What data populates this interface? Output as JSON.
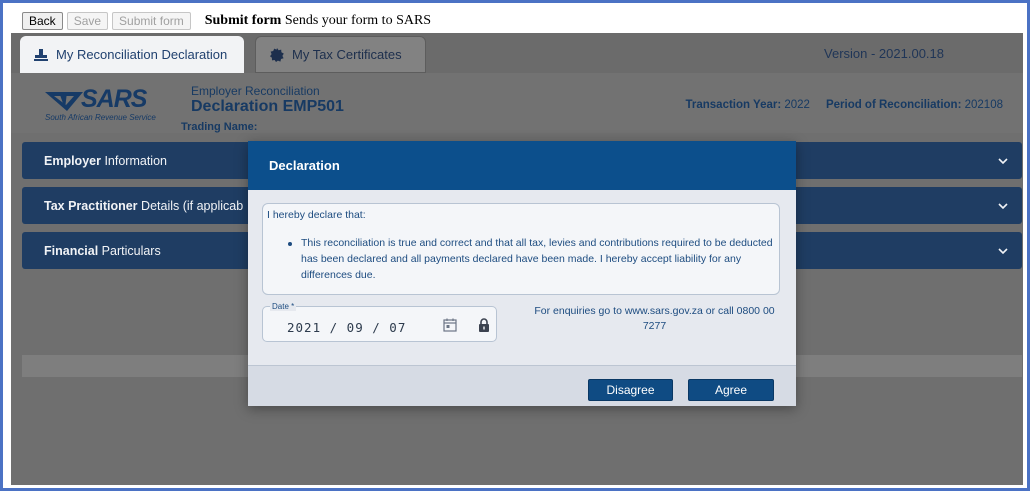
{
  "toolbar": {
    "back_label": "Back",
    "save_label": "Save",
    "submit_label": "Submit form",
    "note_bold": "Submit form",
    "note_text": " Sends your form to SARS"
  },
  "tabs": [
    {
      "label": "My Reconciliation Declaration",
      "icon": "stamp-icon",
      "active": true
    },
    {
      "label": "My Tax Certificates",
      "icon": "seal-icon",
      "active": false
    }
  ],
  "version": "Version - 2021.00.18",
  "header": {
    "logo_word": "SARS",
    "logo_tagline": "South African Revenue Service",
    "subtitle": "Employer Reconciliation",
    "title": "Declaration EMP501",
    "trading_name_label": "Trading Name:",
    "transaction_year_label": "Transaction Year:",
    "transaction_year_value": "2022",
    "period_label": "Period of Reconciliation:",
    "period_value": "202108"
  },
  "sections": [
    {
      "bold": "Employer",
      "rest": " Information"
    },
    {
      "bold": "Tax Practitioner",
      "rest": " Details (if applicab"
    },
    {
      "bold": "Financial",
      "rest": " Particulars"
    }
  ],
  "modal": {
    "title": "Declaration",
    "intro": "I hereby declare that:",
    "declaration_item": "This reconciliation is true and correct and that all tax, levies and contributions required to be deducted has been declared and all payments declared have been made. I hereby accept liability for any differences due.",
    "date_label": "Date *",
    "date_value": "2021 / 09 / 07",
    "enquiry_text": "For enquiries go to www.sars.gov.za or call 0800 00 7277",
    "disagree_label": "Disagree",
    "agree_label": "Agree"
  },
  "colors": {
    "modal_header": "#0c4f8c",
    "section_bar": "#1f3d63",
    "button": "#0f4b83",
    "frame_border": "#4b72c4"
  }
}
